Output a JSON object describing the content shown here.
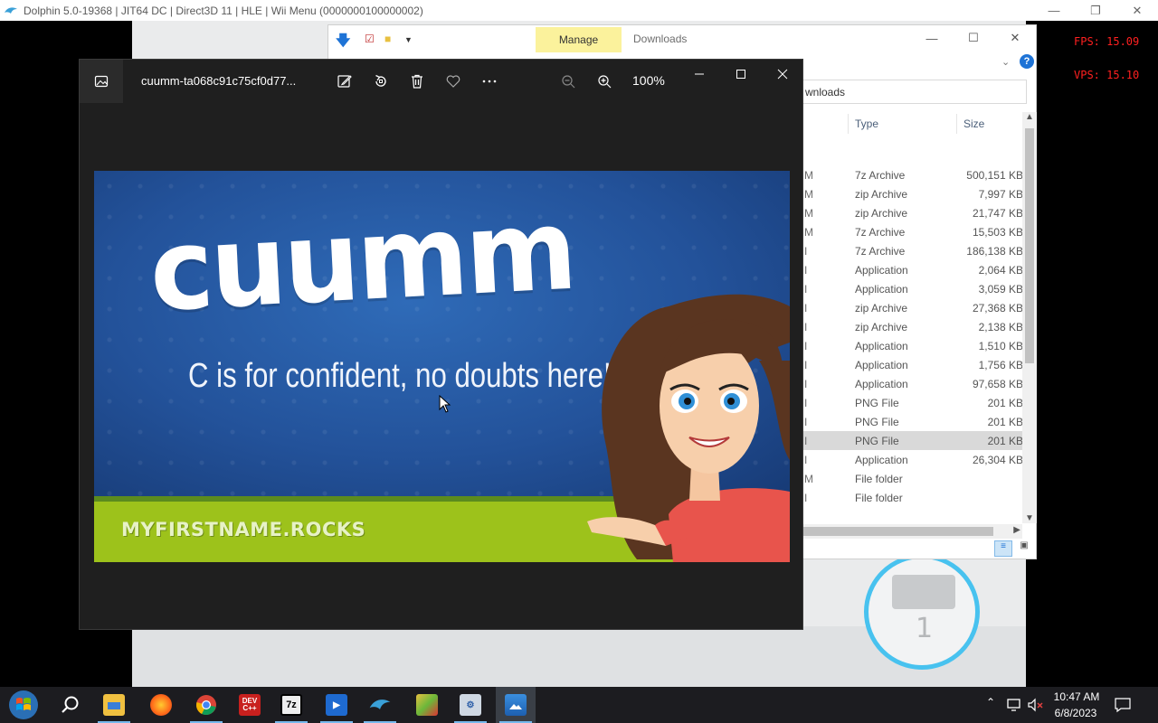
{
  "dolphin": {
    "title": "Dolphin 5.0-19368 | JIT64 DC | Direct3D 11 | HLE | Wii Menu (0000000100000002)",
    "fps": "FPS:  15.09",
    "vps": "VPS:  15.10",
    "wii_mail_count": "1"
  },
  "explorer": {
    "manage_tab": "Manage",
    "title": "Downloads",
    "address": "wnloads",
    "col_type": "Type",
    "col_size": "Size",
    "rows": [
      {
        "date": "M",
        "type": "7z Archive",
        "size": "500,151 KB"
      },
      {
        "date": "M",
        "type": "zip Archive",
        "size": "7,997 KB"
      },
      {
        "date": "M",
        "type": "zip Archive",
        "size": "21,747 KB"
      },
      {
        "date": "M",
        "type": "7z Archive",
        "size": "15,503 KB"
      },
      {
        "date": "I",
        "type": "7z Archive",
        "size": "186,138 KB"
      },
      {
        "date": "I",
        "type": "Application",
        "size": "2,064 KB"
      },
      {
        "date": "I",
        "type": "Application",
        "size": "3,059 KB"
      },
      {
        "date": "I",
        "type": "zip Archive",
        "size": "27,368 KB"
      },
      {
        "date": "I",
        "type": "zip Archive",
        "size": "2,138 KB"
      },
      {
        "date": "I",
        "type": "Application",
        "size": "1,510 KB"
      },
      {
        "date": "I",
        "type": "Application",
        "size": "1,756 KB"
      },
      {
        "date": "I",
        "type": "Application",
        "size": "97,658 KB"
      },
      {
        "date": "I",
        "type": "PNG File",
        "size": "201 KB"
      },
      {
        "date": "I",
        "type": "PNG File",
        "size": "201 KB"
      },
      {
        "date": "I",
        "type": "PNG File",
        "size": "201 KB"
      },
      {
        "date": "I",
        "type": "Application",
        "size": "26,304 KB"
      },
      {
        "date": "M",
        "type": "File folder",
        "size": ""
      },
      {
        "date": "I",
        "type": "File folder",
        "size": ""
      }
    ]
  },
  "photos": {
    "filename": "cuumm-ta068c91c75cf0d77...",
    "zoom": "100%",
    "image": {
      "name": "cuumm",
      "caption": "C is for confident, no doubts here!",
      "footer": "MYFIRSTNAME.ROCKS"
    }
  },
  "taskbar": {
    "apps": [
      "start-button",
      "search",
      "file-explorer",
      "firefox",
      "chrome",
      "dev-cpp",
      "7zip",
      "media-player",
      "dolphin",
      "paint-3d",
      "settings",
      "photos"
    ],
    "clock_time": "10:47 AM",
    "clock_date": "6/8/2023"
  },
  "colors": {
    "image_blue": "#23529a",
    "image_green": "#9dc21b",
    "manage_tab": "#fbf29c",
    "osd_red": "#ff2020"
  }
}
